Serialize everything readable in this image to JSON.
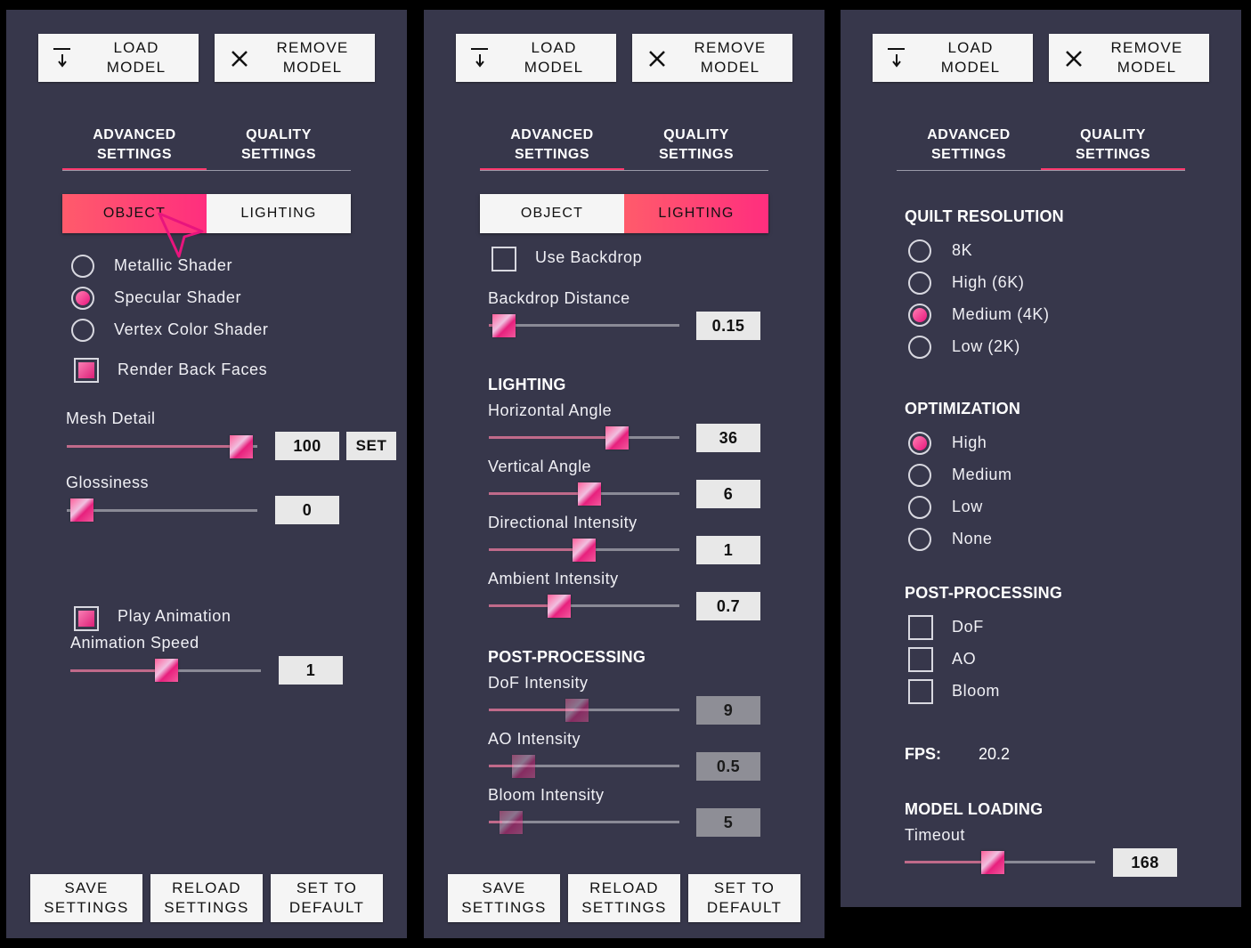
{
  "header": {
    "load_label": "LOAD\nMODEL",
    "remove_label": "REMOVE\nMODEL"
  },
  "tabs": {
    "advanced": "ADVANCED\nSETTINGS",
    "quality": "QUALITY\nSETTINGS"
  },
  "footer": {
    "save": "SAVE\nSETTINGS",
    "reload": "RELOAD\nSETTINGS",
    "default": "SET TO\nDEFAULT"
  },
  "object_panel": {
    "seg_object": "OBJECT",
    "seg_lighting": "LIGHTING",
    "active_segment": "OBJECT",
    "shaders": [
      {
        "label": "Metallic Shader",
        "selected": false
      },
      {
        "label": "Specular Shader",
        "selected": true
      },
      {
        "label": "Vertex Color Shader",
        "selected": false
      }
    ],
    "render_back_faces": {
      "label": "Render Back Faces",
      "checked": true
    },
    "mesh_detail": {
      "label": "Mesh Detail",
      "value": "100",
      "fraction": 0.92,
      "set_label": "SET"
    },
    "glossiness": {
      "label": "Glossiness",
      "value": "0",
      "fraction": 0.0
    },
    "play_animation": {
      "label": "Play Animation",
      "checked": true
    },
    "animation_speed": {
      "label": "Animation Speed",
      "value": "1",
      "fraction": 0.5
    }
  },
  "lighting_panel": {
    "seg_object": "OBJECT",
    "seg_lighting": "LIGHTING",
    "active_segment": "LIGHTING",
    "use_backdrop": {
      "label": "Use Backdrop",
      "checked": false
    },
    "backdrop_distance": {
      "label": "Backdrop Distance",
      "value": "0.15",
      "fraction": 0.03
    },
    "lighting_heading": "LIGHTING",
    "horizontal_angle": {
      "label": "Horizontal Angle",
      "value": "36",
      "fraction": 0.66
    },
    "vertical_angle": {
      "label": "Vertical Angle",
      "value": "6",
      "fraction": 0.53
    },
    "directional_intensity": {
      "label": "Directional Intensity",
      "value": "1",
      "fraction": 0.5
    },
    "ambient_intensity": {
      "label": "Ambient Intensity",
      "value": "0.7",
      "fraction": 0.35
    },
    "post_heading": "POST-PROCESSING",
    "dof_intensity": {
      "label": "DoF Intensity",
      "value": "9",
      "fraction": 0.45
    },
    "ao_intensity": {
      "label": "AO Intensity",
      "value": "0.5",
      "fraction": 0.13
    },
    "bloom_intensity": {
      "label": "Bloom Intensity",
      "value": "5",
      "fraction": 0.07
    }
  },
  "quality_panel": {
    "quilt_heading": "QUILT RESOLUTION",
    "quilt_options": [
      {
        "label": "8K",
        "selected": false
      },
      {
        "label": "High (6K)",
        "selected": false
      },
      {
        "label": "Medium (4K)",
        "selected": true
      },
      {
        "label": "Low (2K)",
        "selected": false
      }
    ],
    "optimization_heading": "OPTIMIZATION",
    "optimization_options": [
      {
        "label": "High",
        "selected": true
      },
      {
        "label": "Medium",
        "selected": false
      },
      {
        "label": "Low",
        "selected": false
      },
      {
        "label": "None",
        "selected": false
      }
    ],
    "post_heading": "POST-PROCESSING",
    "post_options": [
      {
        "label": "DoF",
        "checked": false
      },
      {
        "label": "AO",
        "checked": false
      },
      {
        "label": "Bloom",
        "checked": false
      }
    ],
    "fps_label": "FPS:",
    "fps_value": "20.2",
    "model_loading_heading": "MODEL LOADING",
    "timeout": {
      "label": "Timeout",
      "value": "168",
      "fraction": 0.44
    }
  },
  "colors": {
    "panel": "#37374b",
    "accent": "#ff2e7e",
    "accent_start": "#ff5b6b"
  }
}
